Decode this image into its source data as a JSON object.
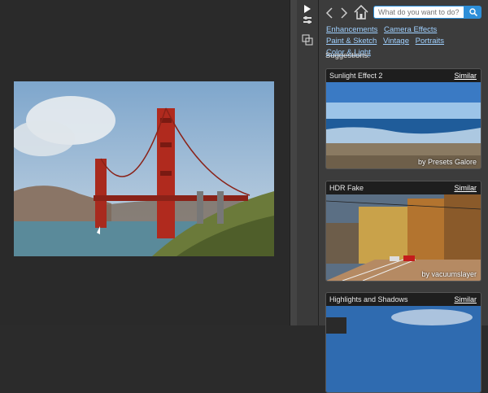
{
  "search": {
    "placeholder": "What do you want to do?"
  },
  "links": [
    "Enhancements",
    "Camera Effects",
    "Paint & Sketch",
    "Vintage",
    "Portraits",
    "Color & Light"
  ],
  "suggestions_label": "Suggestions:",
  "cards": [
    {
      "title": "Sunlight Effect 2",
      "similar": "Similar",
      "credit": "by Presets Galore"
    },
    {
      "title": "HDR Fake",
      "similar": "Similar",
      "credit": "by vacuumslayer"
    },
    {
      "title": "Highlights and Shadows",
      "similar": "Similar",
      "credit": ""
    }
  ],
  "colors": {
    "accent": "#2d8fd9",
    "link": "#9fd0ff"
  }
}
